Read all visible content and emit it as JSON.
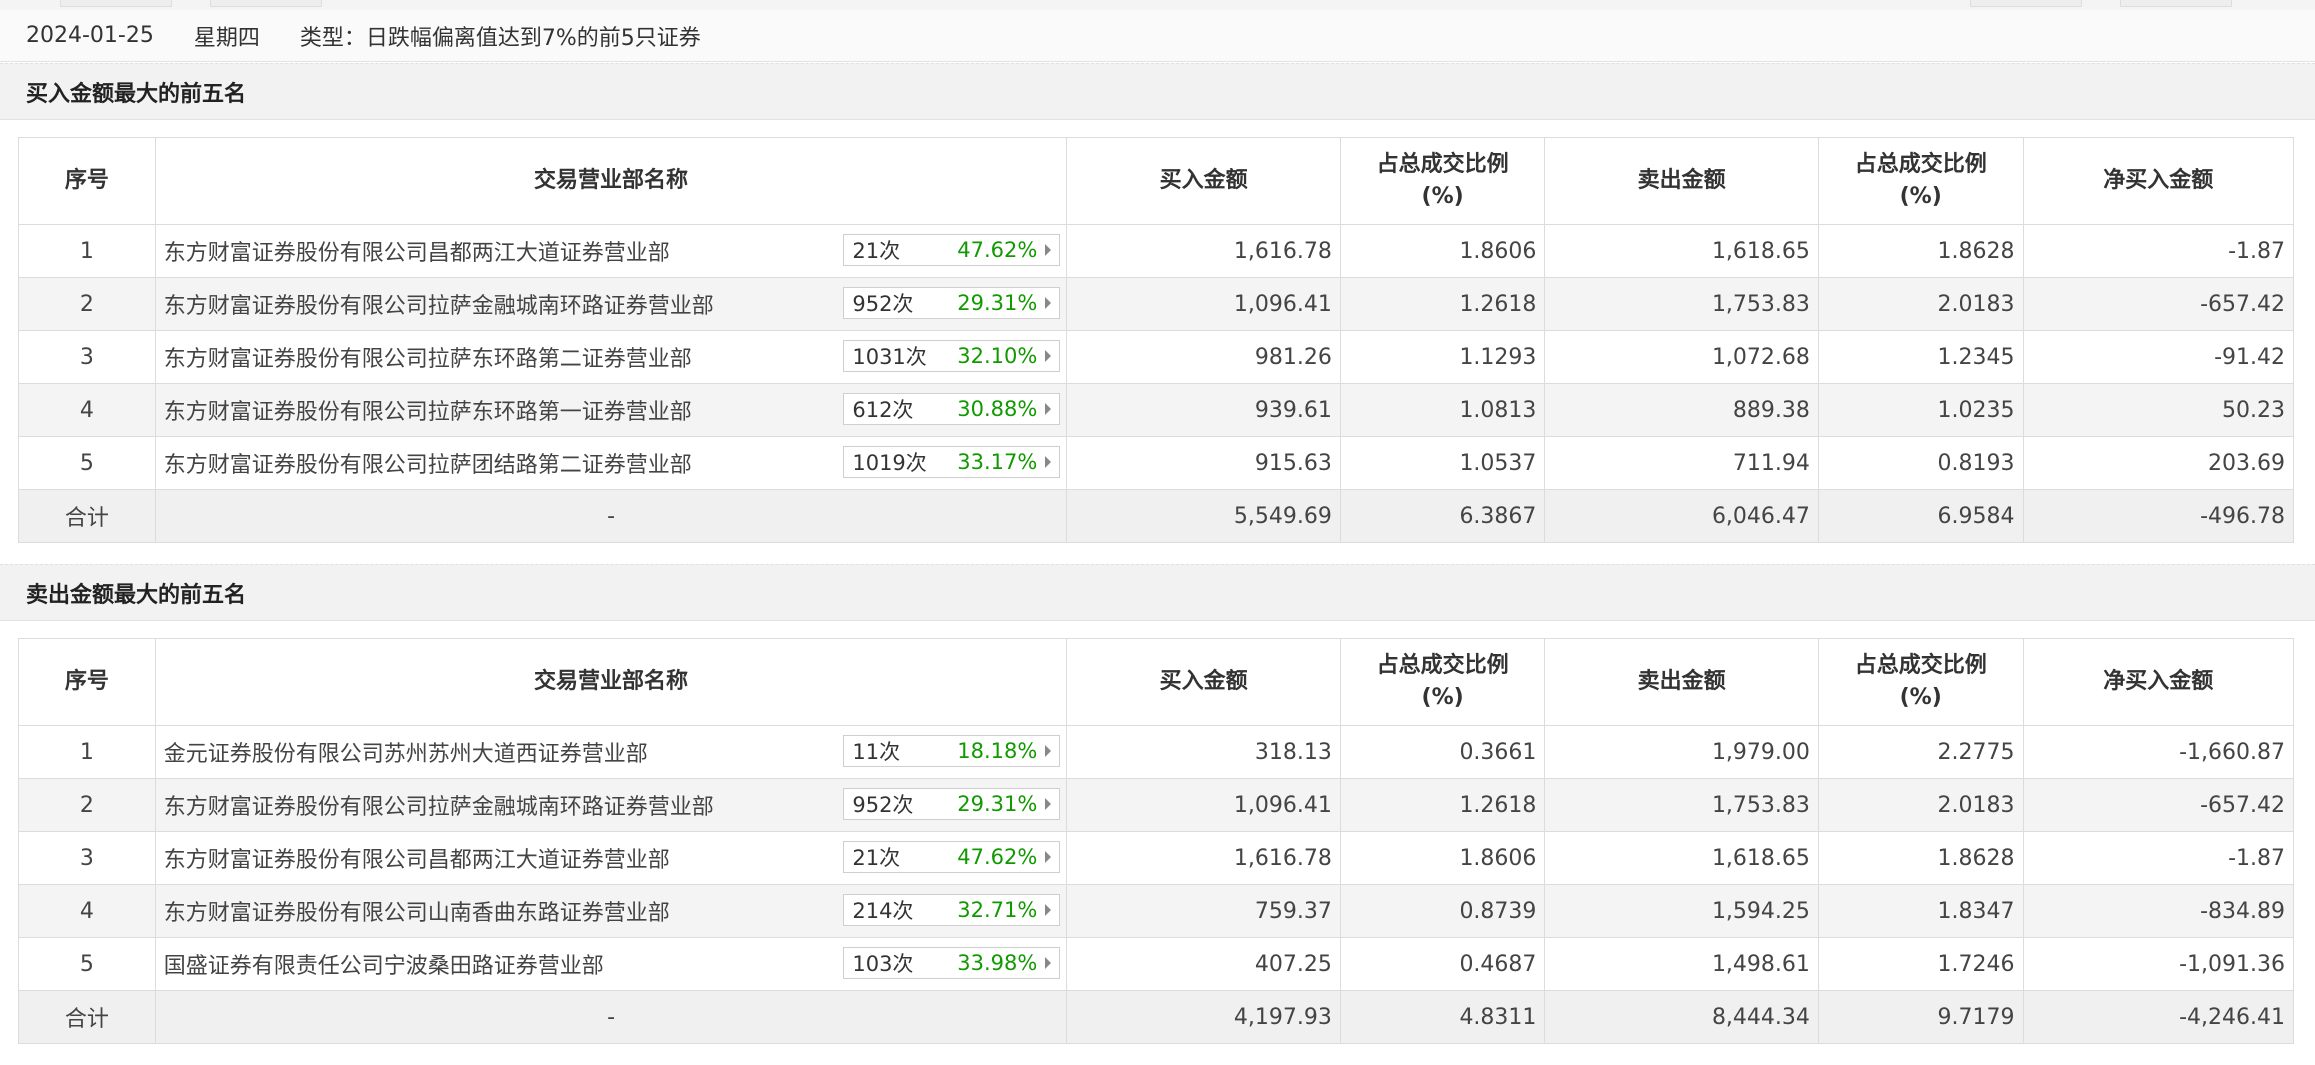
{
  "info": {
    "date": "2024-01-25",
    "weekday": "星期四",
    "type_text": "类型：日跌幅偏离值达到7%的前5只证券"
  },
  "headers": {
    "rank": "序号",
    "branch": "交易营业部名称",
    "buy": "买入金额",
    "buy_ratio_1": "占总成交比例",
    "buy_ratio_2": "(%)",
    "sell": "卖出金额",
    "sell_ratio_1": "占总成交比例",
    "sell_ratio_2": "(%)",
    "net": "净买入金额"
  },
  "colors": {
    "up": "#ff0000",
    "down": "#119900"
  },
  "buy_section": {
    "title": "买入金额最大的前五名",
    "rows": [
      {
        "rank": "1",
        "name": "东方财富证券股份有限公司昌都两江大道证券营业部",
        "times": "21次",
        "rate": "47.62%",
        "buy": "1,616.78",
        "buy_ratio": "1.8606",
        "sell": "1,618.65",
        "sell_ratio": "1.8628",
        "net": "-1.87"
      },
      {
        "rank": "2",
        "name": "东方财富证券股份有限公司拉萨金融城南环路证券营业部",
        "times": "952次",
        "rate": "29.31%",
        "buy": "1,096.41",
        "buy_ratio": "1.2618",
        "sell": "1,753.83",
        "sell_ratio": "2.0183",
        "net": "-657.42"
      },
      {
        "rank": "3",
        "name": "东方财富证券股份有限公司拉萨东环路第二证券营业部",
        "times": "1031次",
        "rate": "32.10%",
        "buy": "981.26",
        "buy_ratio": "1.1293",
        "sell": "1,072.68",
        "sell_ratio": "1.2345",
        "net": "-91.42"
      },
      {
        "rank": "4",
        "name": "东方财富证券股份有限公司拉萨东环路第一证券营业部",
        "times": "612次",
        "rate": "30.88%",
        "buy": "939.61",
        "buy_ratio": "1.0813",
        "sell": "889.38",
        "sell_ratio": "1.0235",
        "net": "50.23"
      },
      {
        "rank": "5",
        "name": "东方财富证券股份有限公司拉萨团结路第二证券营业部",
        "times": "1019次",
        "rate": "33.17%",
        "buy": "915.63",
        "buy_ratio": "1.0537",
        "sell": "711.94",
        "sell_ratio": "0.8193",
        "net": "203.69"
      }
    ],
    "total": {
      "label": "合计",
      "name": "-",
      "buy": "5,549.69",
      "buy_ratio": "6.3867",
      "sell": "6,046.47",
      "sell_ratio": "6.9584",
      "net": "-496.78"
    }
  },
  "sell_section": {
    "title": "卖出金额最大的前五名",
    "rows": [
      {
        "rank": "1",
        "name": "金元证券股份有限公司苏州苏州大道西证券营业部",
        "times": "11次",
        "rate": "18.18%",
        "buy": "318.13",
        "buy_ratio": "0.3661",
        "sell": "1,979.00",
        "sell_ratio": "2.2775",
        "net": "-1,660.87"
      },
      {
        "rank": "2",
        "name": "东方财富证券股份有限公司拉萨金融城南环路证券营业部",
        "times": "952次",
        "rate": "29.31%",
        "buy": "1,096.41",
        "buy_ratio": "1.2618",
        "sell": "1,753.83",
        "sell_ratio": "2.0183",
        "net": "-657.42"
      },
      {
        "rank": "3",
        "name": "东方财富证券股份有限公司昌都两江大道证券营业部",
        "times": "21次",
        "rate": "47.62%",
        "buy": "1,616.78",
        "buy_ratio": "1.8606",
        "sell": "1,618.65",
        "sell_ratio": "1.8628",
        "net": "-1.87"
      },
      {
        "rank": "4",
        "name": "东方财富证券股份有限公司山南香曲东路证券营业部",
        "times": "214次",
        "rate": "32.71%",
        "buy": "759.37",
        "buy_ratio": "0.8739",
        "sell": "1,594.25",
        "sell_ratio": "1.8347",
        "net": "-834.89"
      },
      {
        "rank": "5",
        "name": "国盛证券有限责任公司宁波桑田路证券营业部",
        "times": "103次",
        "rate": "33.98%",
        "buy": "407.25",
        "buy_ratio": "0.4687",
        "sell": "1,498.61",
        "sell_ratio": "1.7246",
        "net": "-1,091.36"
      }
    ],
    "total": {
      "label": "合计",
      "name": "-",
      "buy": "4,197.93",
      "buy_ratio": "4.8311",
      "sell": "8,444.34",
      "sell_ratio": "9.7179",
      "net": "-4,246.41"
    }
  }
}
